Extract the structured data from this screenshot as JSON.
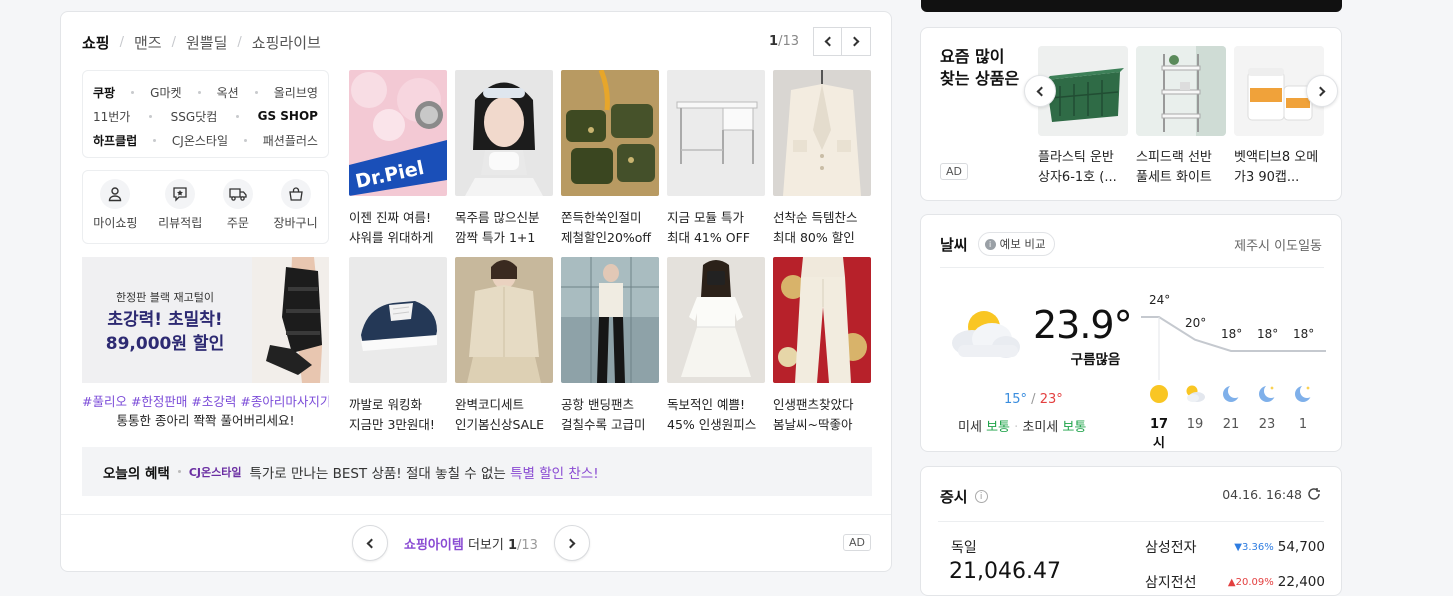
{
  "shopping": {
    "tabs": [
      "쇼핑",
      "맨즈",
      "원쁠딜",
      "쇼핑라이브"
    ],
    "page_current": "1",
    "page_total": "/13",
    "malls": [
      [
        "쿠팡",
        "G마켓",
        "옥션",
        "올리브영"
      ],
      [
        "11번가",
        "SSG닷컴",
        "GS SHOP"
      ],
      [
        "하프클럽",
        "CJ온스타일",
        "패션플러스"
      ]
    ],
    "services": [
      "마이쇼핑",
      "리뷰적립",
      "주문",
      "장바구니"
    ],
    "banner": {
      "line1": "한정판 블랙 재고털이",
      "line2": "초강력! 초밀착!",
      "line3": "89,000원 할인",
      "tags": "#풀리오 #한정판매 #초강력 #종아리마사지기",
      "desc": "통통한 종아리 쫙쫙 풀어버리세요!"
    },
    "products": [
      {
        "l1": "이젠 진짜 여름!",
        "l2": "샤워를 위대하게"
      },
      {
        "l1": "목주름 많으신분",
        "l2": "깜짝 특가 1+1"
      },
      {
        "l1": "쫀득한쑥인절미",
        "l2": "제철할인20%off"
      },
      {
        "l1": "지금 모듈 특가",
        "l2": "최대 41% OFF"
      },
      {
        "l1": "선착순 득템찬스",
        "l2": "최대 80% 할인"
      },
      {
        "l1": "까발로 워킹화",
        "l2": "지금만 3만원대!"
      },
      {
        "l1": "완벽코디세트",
        "l2": "인기봄신상SALE"
      },
      {
        "l1": "공항 밴딩팬츠",
        "l2": "걸칠수록 고급미"
      },
      {
        "l1": "독보적인 예쁨!",
        "l2": "45% 인생원피스"
      },
      {
        "l1": "인생팬츠찾았다",
        "l2": "봄날씨~딱좋아"
      }
    ],
    "benefit": {
      "title": "오늘의 혜택",
      "brand": "CJ온스타일",
      "text": "특가로 만나는 BEST 상품! 절대 놓칠 수 없는",
      "highlight": "특별 할인 찬스!"
    },
    "more": {
      "highlight": "쇼핑아이템",
      "label": "더보기",
      "current": "1",
      "total": "/13"
    },
    "ad_label": "AD"
  },
  "recommend": {
    "title": "요즘 많이 찾는 상품은",
    "items": [
      {
        "name": "플라스틱 운반 상자6-1호 (..."
      },
      {
        "name": "스피드랙 선반 풀세트 화이트"
      },
      {
        "name": "벳액티브8 오메가3 90캡..."
      }
    ],
    "ad_label": "AD"
  },
  "weather": {
    "title": "날씨",
    "compare": "예보 비교",
    "location": "제주시 이도일동",
    "temp": "23.9°",
    "condition": "구름많음",
    "min": "15°",
    "max": "23°",
    "dust_label": "미세",
    "dust_value": "보통",
    "ultra_label": "초미세",
    "ultra_value": "보통",
    "hourly": [
      {
        "time": "17시",
        "temp": "24°",
        "icon": "sun-icon"
      },
      {
        "time": "19",
        "temp": "20°",
        "icon": "cloud-sun-icon"
      },
      {
        "time": "21",
        "temp": "18°",
        "icon": "moon-icon"
      },
      {
        "time": "23",
        "temp": "18°",
        "icon": "moon-star-icon"
      },
      {
        "time": "1",
        "temp": "18°",
        "icon": "moon-star-icon"
      }
    ],
    "hourly_temps_c": [
      24,
      20,
      18,
      18,
      18
    ]
  },
  "stock": {
    "title": "증시",
    "time": "04.16. 16:48",
    "index_name": "독일",
    "index_value": "21,046.47",
    "rows": [
      {
        "name": "삼성전자",
        "pct": "3.36%",
        "value": "54,700",
        "dir": "down"
      },
      {
        "name": "삼지전선",
        "pct": "20.09%",
        "value": "22,400",
        "dir": "up"
      }
    ]
  },
  "colors": {
    "accent": "#8a4bd3",
    "banner_text": "#2d2a72",
    "up": "#e34040",
    "down": "#2f7de1",
    "good": "#1fa34a"
  }
}
